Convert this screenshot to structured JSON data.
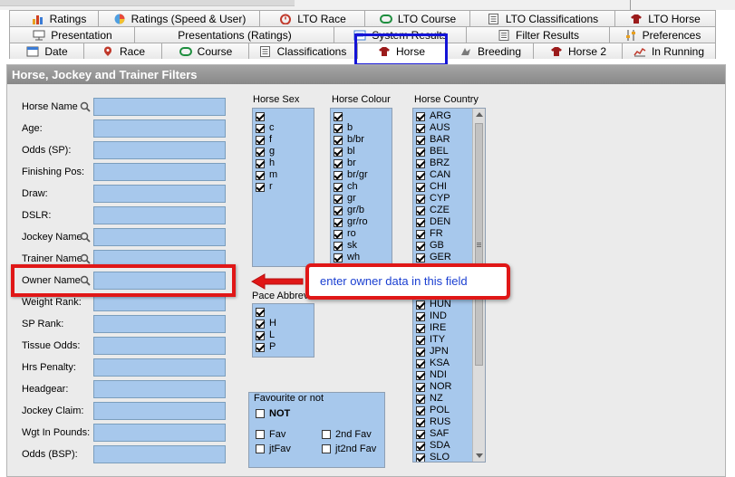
{
  "tabs_row1": [
    {
      "label": "Ratings",
      "icon": "bar-chart-icon"
    },
    {
      "label": "Ratings (Speed & User)",
      "icon": "pie-chart-icon"
    },
    {
      "label": "LTO Race",
      "icon": "stopwatch-icon"
    },
    {
      "label": "LTO Course",
      "icon": "racecourse-icon"
    },
    {
      "label": "LTO Classifications",
      "icon": "classification-icon"
    },
    {
      "label": "LTO Horse",
      "icon": "horse-silk-icon"
    }
  ],
  "tabs_row2": [
    {
      "label": "Presentation",
      "icon": "presentation-icon"
    },
    {
      "label": "Presentations (Ratings)",
      "icon": ""
    },
    {
      "label": "System Results",
      "icon": "system-results-icon"
    },
    {
      "label": "Filter Results",
      "icon": "filter-icon"
    },
    {
      "label": "Preferences",
      "icon": "sliders-icon"
    }
  ],
  "tabs_row3": [
    {
      "label": "Date",
      "icon": "calendar-icon"
    },
    {
      "label": "Race",
      "icon": "location-pin-icon"
    },
    {
      "label": "Course",
      "icon": "racecourse-icon"
    },
    {
      "label": "Classifications",
      "icon": "classification-icon"
    },
    {
      "label": "Horse",
      "icon": "horse-silk-icon",
      "active": true
    },
    {
      "label": "Breeding",
      "icon": "breeding-icon"
    },
    {
      "label": "Horse 2",
      "icon": "horse-silk-icon"
    },
    {
      "label": "In Running",
      "icon": "line-chart-icon"
    }
  ],
  "panel": {
    "title": "Horse, Jockey and Trainer Filters"
  },
  "fields": [
    {
      "label": "Horse Name",
      "value": "",
      "search": true
    },
    {
      "label": "Age:",
      "value": ""
    },
    {
      "label": "Odds (SP):",
      "value": ""
    },
    {
      "label": "Finishing Pos:",
      "value": ""
    },
    {
      "label": "Draw:",
      "value": ""
    },
    {
      "label": "DSLR:",
      "value": ""
    },
    {
      "label": "Jockey Name",
      "value": "",
      "search": true
    },
    {
      "label": "Trainer Name",
      "value": "",
      "search": true
    },
    {
      "label": "Owner Name",
      "value": "",
      "search": true
    },
    {
      "label": "Weight Rank:",
      "value": ""
    },
    {
      "label": "SP Rank:",
      "value": ""
    },
    {
      "label": "Tissue Odds:",
      "value": ""
    },
    {
      "label": "Hrs Penalty:",
      "value": ""
    },
    {
      "label": "Headgear:",
      "value": ""
    },
    {
      "label": "Jockey Claim:",
      "value": ""
    },
    {
      "label": "Wgt In Pounds:",
      "value": ""
    },
    {
      "label": "Odds (BSP):",
      "value": ""
    }
  ],
  "horse_sex": {
    "label": "Horse Sex",
    "items": [
      "",
      "c",
      "f",
      "g",
      "h",
      "m",
      "r"
    ]
  },
  "horse_colour": {
    "label": "Horse Colour",
    "items": [
      "",
      "b",
      "b/br",
      "bl",
      "br",
      "br/gr",
      "ch",
      "gr",
      "gr/b",
      "gr/ro",
      "ro",
      "sk",
      "wh"
    ]
  },
  "horse_country": {
    "label": "Horse Country",
    "items": [
      "ARG",
      "AUS",
      "BAR",
      "BEL",
      "BRZ",
      "CAN",
      "CHI",
      "CYP",
      "CZE",
      "DEN",
      "FR",
      "GB",
      "GER",
      "",
      "",
      "",
      "HUN",
      "IND",
      "IRE",
      "ITY",
      "JPN",
      "KSA",
      "NDI",
      "NOR",
      "NZ",
      "POL",
      "RUS",
      "SAF",
      "SDA",
      "SLO"
    ]
  },
  "pace": {
    "label": "Pace Abbrev",
    "items": [
      "",
      "H",
      "L",
      "P"
    ]
  },
  "favourite": {
    "title": "Favourite or not",
    "not_label": "NOT",
    "options": [
      "Fav",
      "2nd Fav",
      "jtFav",
      "jt2nd Fav"
    ]
  },
  "annotation": {
    "text": "enter owner data in this field"
  },
  "colors": {
    "accent_highlight": "#1414d6",
    "annotation_red": "#e01717",
    "field_blue": "#a7c8ec",
    "annotation_text": "#1a3fd1"
  }
}
